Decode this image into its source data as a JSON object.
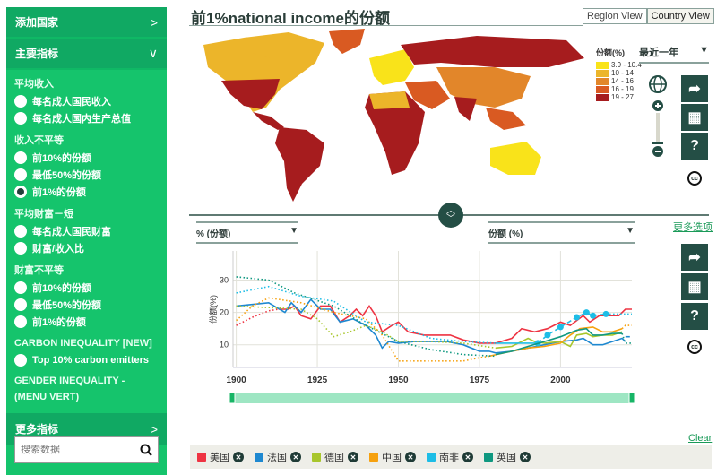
{
  "sidebar": {
    "add_country": "添加国家",
    "main_indicators": "主要指标",
    "groups": [
      {
        "label": "平均收入",
        "options": [
          {
            "label": "每名成人国民收入",
            "selected": false
          },
          {
            "label": "每名成人国内生产总值",
            "selected": false
          }
        ]
      },
      {
        "label": "收入不平等",
        "options": [
          {
            "label": "前10%的份额",
            "selected": false
          },
          {
            "label": "最低50%的份额",
            "selected": false
          },
          {
            "label": "前1%的份额",
            "selected": true
          }
        ]
      },
      {
        "label": "平均财富－短",
        "options": [
          {
            "label": "每名成人国民财富",
            "selected": false
          },
          {
            "label": "财富/收入比",
            "selected": false
          }
        ]
      },
      {
        "label": "财富不平等",
        "options": [
          {
            "label": "前10%的份额",
            "selected": false
          },
          {
            "label": "最低50%的份额",
            "selected": false
          },
          {
            "label": "前1%的份额",
            "selected": false
          }
        ]
      },
      {
        "label": "CARBON INEQUALITY [NEW]",
        "options": [
          {
            "label": "Top 10% carbon emitters",
            "selected": false
          }
        ]
      }
    ],
    "gender": "GENDER INEQUALITY - (MENU VERT)",
    "more_indicators": "更多指标",
    "search_placeholder": "搜索数据"
  },
  "header": {
    "title": "前1%national income的份额",
    "tabs": [
      "Region View",
      "Country View"
    ],
    "active_tab": "Country View"
  },
  "map": {
    "period": "最近一年",
    "legend_title": "份额(%)",
    "legend": [
      {
        "range": "3.9 - 10.4",
        "color": "#f9e31a"
      },
      {
        "range": "10 - 14",
        "color": "#ecb52a"
      },
      {
        "range": "14 - 16",
        "color": "#e2862a"
      },
      {
        "range": "16 - 19",
        "color": "#d95a22"
      },
      {
        "range": "19 - 27",
        "color": "#a61c1e"
      }
    ]
  },
  "tools": {
    "share": "share-icon",
    "table": "table-icon",
    "help": "?",
    "license": "cc"
  },
  "chart_controls": {
    "left_select": "% (份额)",
    "right_select": "份额 (%)",
    "more_options": "更多选项",
    "clear": "Clear"
  },
  "chart_data": {
    "type": "line",
    "ylabel": "份额(%)",
    "xlim": [
      1899,
      2022
    ],
    "ylim": [
      3,
      39
    ],
    "xticks": [
      1900,
      1925,
      1950,
      1975,
      2000
    ],
    "yticks": [
      10,
      20,
      30
    ],
    "grid": true,
    "series": [
      {
        "name": "美国",
        "color": "#ee3342",
        "segments": [
          {
            "style": "dotted",
            "points": [
              [
                1900,
                16
              ],
              [
                1905,
                18.5
              ],
              [
                1910,
                20.5
              ],
              [
                1913,
                21
              ]
            ]
          },
          {
            "style": "solid",
            "points": [
              [
                1913,
                21
              ],
              [
                1916,
                21
              ],
              [
                1918,
                22
              ],
              [
                1920,
                19
              ],
              [
                1923,
                18
              ],
              [
                1926,
                22
              ],
              [
                1929,
                22
              ],
              [
                1932,
                17
              ],
              [
                1935,
                19
              ],
              [
                1937,
                21
              ],
              [
                1939,
                19
              ],
              [
                1941,
                22
              ],
              [
                1943,
                19
              ],
              [
                1945,
                14
              ],
              [
                1948,
                16
              ],
              [
                1950,
                17
              ],
              [
                1953,
                14
              ],
              [
                1958,
                13
              ],
              [
                1962,
                13
              ],
              [
                1966,
                13
              ],
              [
                1970,
                11.5
              ],
              [
                1975,
                10.5
              ],
              [
                1980,
                10.5
              ],
              [
                1985,
                12
              ],
              [
                1988,
                15
              ],
              [
                1992,
                14
              ],
              [
                1996,
                15
              ],
              [
                2000,
                17
              ],
              [
                2003,
                16
              ],
              [
                2007,
                19
              ],
              [
                2009,
                17
              ],
              [
                2012,
                19
              ],
              [
                2015,
                19
              ],
              [
                2018,
                19
              ],
              [
                2020,
                21
              ],
              [
                2022,
                21
              ]
            ]
          }
        ]
      },
      {
        "name": "法国",
        "color": "#1e88d0",
        "segments": [
          {
            "style": "solid",
            "points": [
              [
                1900,
                22
              ],
              [
                1910,
                23
              ],
              [
                1915,
                20
              ],
              [
                1917,
                23
              ],
              [
                1920,
                20
              ],
              [
                1923,
                24
              ],
              [
                1926,
                21
              ],
              [
                1929,
                21
              ],
              [
                1932,
                17
              ],
              [
                1936,
                18
              ],
              [
                1940,
                16
              ],
              [
                1943,
                13
              ],
              [
                1945,
                9
              ],
              [
                1947,
                11
              ],
              [
                1950,
                10.5
              ],
              [
                1955,
                11
              ],
              [
                1960,
                11
              ],
              [
                1965,
                11
              ],
              [
                1970,
                10
              ],
              [
                1975,
                8
              ],
              [
                1978,
                8
              ],
              [
                1980,
                7.5
              ],
              [
                1985,
                8
              ],
              [
                1990,
                9
              ],
              [
                1995,
                10
              ],
              [
                2000,
                11
              ],
              [
                2005,
                11.5
              ],
              [
                2007,
                12
              ],
              [
                2010,
                10
              ],
              [
                2013,
                10
              ],
              [
                2016,
                11
              ],
              [
                2019,
                12
              ],
              [
                2020,
                11
              ]
            ]
          },
          {
            "style": "dashed",
            "points": [
              [
                2020,
                12.5
              ],
              [
                2022,
                12.5
              ]
            ]
          }
        ]
      },
      {
        "name": "德国",
        "color": "#a8c62c",
        "segments": [
          {
            "style": "dotted",
            "points": [
              [
                1900,
                22
              ],
              [
                1910,
                21.5
              ],
              [
                1920,
                21
              ],
              [
                1925,
                18
              ],
              [
                1930,
                12.5
              ],
              [
                1935,
                14
              ],
              [
                1940,
                16
              ],
              [
                1945,
                14
              ],
              [
                1950,
                11
              ],
              [
                1960,
                11
              ],
              [
                1970,
                10.5
              ],
              [
                1980,
                9
              ]
            ]
          },
          {
            "style": "solid",
            "points": [
              [
                1980,
                9
              ],
              [
                1985,
                9.5
              ],
              [
                1990,
                12
              ],
              [
                1992,
                11
              ],
              [
                1995,
                10.5
              ],
              [
                2000,
                11
              ],
              [
                2003,
                9.5
              ],
              [
                2005,
                13
              ],
              [
                2008,
                13.5
              ],
              [
                2010,
                12.5
              ],
              [
                2013,
                13
              ],
              [
                2016,
                13
              ],
              [
                2019,
                14
              ]
            ]
          }
        ]
      },
      {
        "name": "中国",
        "color": "#f6a10f",
        "segments": [
          {
            "style": "dotted",
            "points": [
              [
                1900,
                17.5
              ],
              [
                1905,
                22
              ],
              [
                1910,
                24.5
              ],
              [
                1920,
                23
              ],
              [
                1930,
                20
              ],
              [
                1940,
                18
              ],
              [
                1945,
                13
              ],
              [
                1950,
                5
              ],
              [
                1960,
                5
              ],
              [
                1970,
                5
              ],
              [
                1975,
                6
              ],
              [
                1978,
                6.5
              ]
            ]
          },
          {
            "style": "solid",
            "points": [
              [
                1978,
                6.5
              ],
              [
                1985,
                8
              ],
              [
                1990,
                9
              ],
              [
                1995,
                9.5
              ],
              [
                2000,
                10.5
              ],
              [
                2003,
                13
              ],
              [
                2006,
                15
              ],
              [
                2010,
                15.5
              ],
              [
                2013,
                14
              ],
              [
                2016,
                14
              ],
              [
                2019,
                15
              ]
            ]
          },
          {
            "style": "dotted",
            "points": [
              [
                2019,
                15
              ],
              [
                2020,
                16
              ],
              [
                2022,
                16
              ]
            ]
          }
        ]
      },
      {
        "name": "南非",
        "color": "#1dbde6",
        "segments": [
          {
            "style": "dotted",
            "points": [
              [
                1900,
                26
              ],
              [
                1910,
                28
              ],
              [
                1920,
                25
              ],
              [
                1930,
                23.5
              ],
              [
                1940,
                17
              ],
              [
                1950,
                16
              ],
              [
                1960,
                12
              ],
              [
                1970,
                11
              ],
              [
                1980,
                10.5
              ]
            ]
          },
          {
            "style": "solid",
            "points": [
              [
                1980,
                10.5
              ],
              [
                1993,
                10.5
              ]
            ]
          },
          {
            "style": "dashed",
            "markers": true,
            "points": [
              [
                1993,
                10.5
              ],
              [
                1996,
                13
              ],
              [
                2000,
                15.5
              ],
              [
                2005,
                18.5
              ],
              [
                2008,
                20
              ],
              [
                2010,
                19
              ],
              [
                2014,
                19.5
              ]
            ]
          },
          {
            "style": "dotted",
            "points": [
              [
                2014,
                19.5
              ],
              [
                2022,
                19.5
              ]
            ]
          }
        ]
      },
      {
        "name": "英国",
        "color": "#0f9880",
        "segments": [
          {
            "style": "dotted",
            "points": [
              [
                1900,
                31
              ],
              [
                1910,
                30
              ],
              [
                1918,
                26
              ],
              [
                1930,
                22
              ],
              [
                1940,
                16
              ],
              [
                1950,
                11
              ],
              [
                1960,
                8.5
              ],
              [
                1970,
                7
              ],
              [
                1980,
                6.5
              ]
            ]
          },
          {
            "style": "solid",
            "points": [
              [
                1980,
                7
              ],
              [
                1985,
                8
              ],
              [
                1990,
                9.5
              ],
              [
                1995,
                11
              ],
              [
                2000,
                12.5
              ],
              [
                2005,
                14.5
              ],
              [
                2008,
                15
              ],
              [
                2010,
                13
              ],
              [
                2013,
                13
              ],
              [
                2016,
                13.5
              ],
              [
                2019,
                13.5
              ]
            ]
          },
          {
            "style": "dotted",
            "points": [
              [
                2019,
                13.5
              ],
              [
                2020,
                10.5
              ],
              [
                2022,
                10.5
              ]
            ]
          }
        ]
      }
    ]
  }
}
